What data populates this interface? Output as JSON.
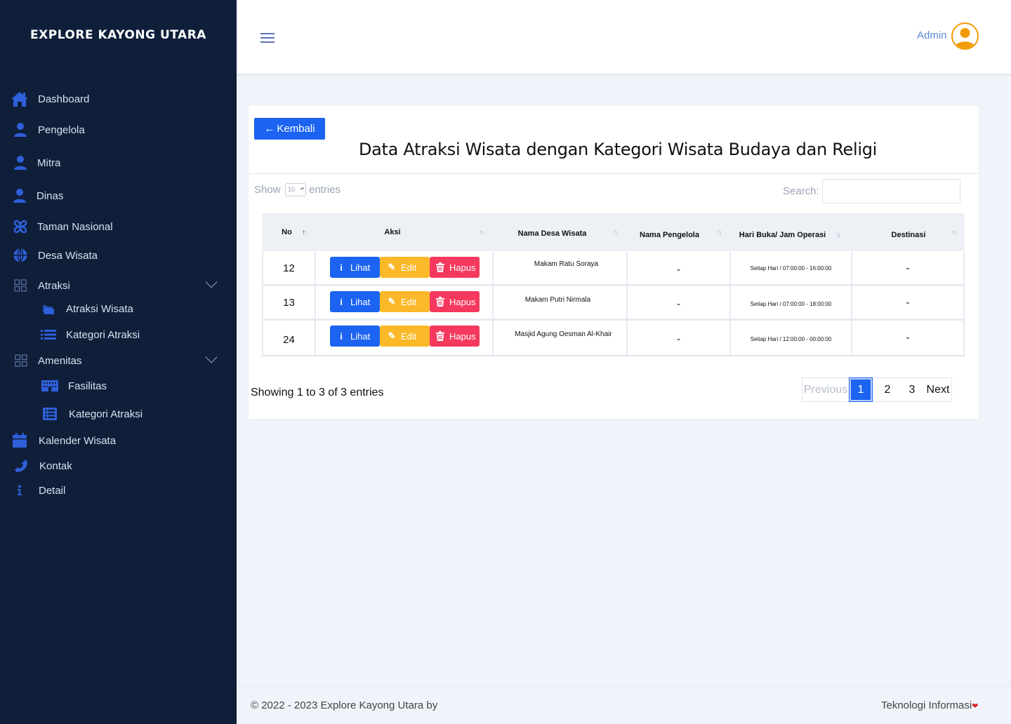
{
  "brand": "EXPLORE KAYONG UTARA",
  "sidebar": {
    "items": [
      {
        "label": "Dashboard",
        "icon": "home-icon"
      },
      {
        "label": "Pengelola",
        "icon": "user-icon"
      },
      {
        "label": "Mitra",
        "icon": "user-icon"
      },
      {
        "label": "Dinas",
        "icon": "user-icon"
      },
      {
        "label": "Taman Nasional",
        "icon": "fan-icon"
      },
      {
        "label": "Desa Wisata",
        "icon": "globe-icon"
      },
      {
        "label": "Atraksi",
        "icon": "grid-icon"
      },
      {
        "label": "Atraksi Wisata",
        "icon": "folder-icon"
      },
      {
        "label": "Kategori Atraksi",
        "icon": "list-icon"
      },
      {
        "label": "Amenitas",
        "icon": "grid-icon"
      },
      {
        "label": "Fasilitas",
        "icon": "building-icon"
      },
      {
        "label": "Kategori Atraksi",
        "icon": "list-alt-icon"
      },
      {
        "label": "Kalender Wisata",
        "icon": "calendar-icon"
      },
      {
        "label": "Kontak",
        "icon": "phone-icon"
      },
      {
        "label": "Detail",
        "icon": "info-icon"
      }
    ]
  },
  "header": {
    "user": "Admin"
  },
  "card": {
    "back_label": "Kembali",
    "title": "Data Atraksi Wisata dengan Kategori Wisata Budaya dan Religi",
    "show_label": "Show",
    "show_value": "10",
    "entries_label": "entries",
    "search_label": "Search:",
    "search_value": ""
  },
  "table": {
    "columns": [
      "No",
      "Aksi",
      "Nama Desa Wisata",
      "Nama Pengelola",
      "Hari Buka/ Jam Operasi",
      "Destinasi"
    ],
    "actions": {
      "view": "Lihat",
      "edit": "Edit",
      "delete": "Hapus"
    },
    "rows": [
      {
        "no": "12",
        "nama_desa": "Makam Ratu Soraya",
        "pengelola": "-",
        "jam": "Setiap Hari / 07:00:00 - 16:00:00",
        "destinasi": "-"
      },
      {
        "no": "13",
        "nama_desa": "Makam Putri Nirmala",
        "pengelola": "-",
        "jam": "Setiap Hari / 07:00:00 - 18:00:00",
        "destinasi": "-"
      },
      {
        "no": "24",
        "nama_desa": "Masjid Agung Oesman Al-Khair",
        "pengelola": "-",
        "jam": "Setiap Hari / 12:00:00 - 00:00:00",
        "destinasi": "-"
      }
    ]
  },
  "pagination": {
    "info": "Showing 1 to 3 of 3 entries",
    "previous": "Previous",
    "pages": [
      "1",
      "2",
      "3"
    ],
    "next": "Next",
    "current": "1"
  },
  "footer": {
    "left": "© 2022 - 2023 Explore Kayong Utara by",
    "right": "Teknologi Informasi"
  },
  "colors": {
    "sidebar_bg": "#0f1f3a",
    "primary": "#1b63f0",
    "warning": "#fbb929",
    "danger": "#f5385d",
    "icon_blue": "#2f5fd9"
  }
}
